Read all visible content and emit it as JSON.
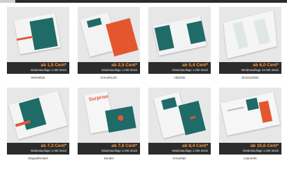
{
  "products": [
    {
      "price": "ab 1,5 Cent*",
      "min_order": "Mindestauflage 1.000 Stück",
      "name": "Wickelfalz"
    },
    {
      "price": "ab 2,5 Cent*",
      "min_order": "Mindestauflage 1.000 Stück",
      "name": "Kreuzbruch"
    },
    {
      "price": "ab 5,4 Cent*",
      "min_order": "Mindestauflage 1.000 Stück",
      "name": "Altarfalz"
    },
    {
      "price": "ab 6,0 Cent*",
      "min_order": "Mindestauflage 10.000 Stück",
      "name": "Zickzackfalz"
    },
    {
      "price": "ab 7,3 Cent*",
      "min_order": "Mindestauflage 1.000 Stück",
      "name": "Doppelfenster"
    },
    {
      "price": "ab 7,6 Cent*",
      "min_order": "Mindestauflage 4.000 Stück",
      "name": "Sonder"
    },
    {
      "price": "ab 8,4 Cent*",
      "min_order": "Mindestauflage 1.000 Stück",
      "name": "Kreuzfalz"
    },
    {
      "price": "ab 10,6 Cent*",
      "min_order": "Mindestauflage 1.000 Stück",
      "name": "Leporello"
    }
  ],
  "mockup_text": {
    "surprise": "Surprise"
  },
  "colors": {
    "teal": "#1f6b68",
    "orange": "#e4572e",
    "dark": "#2c2c2c",
    "price": "#ff9a3d"
  }
}
